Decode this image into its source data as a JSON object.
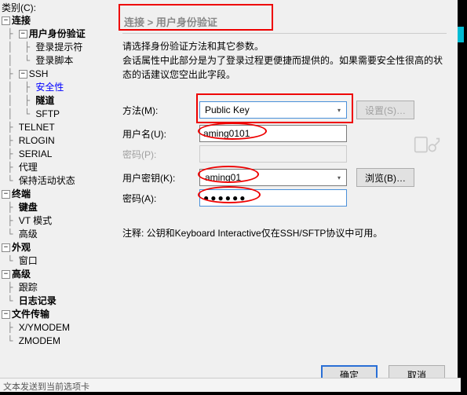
{
  "category_label": "类别(C):",
  "tree": {
    "connection": "连接",
    "auth": "用户身份验证",
    "login_prompt": "登录提示符",
    "login_script": "登录脚本",
    "ssh": "SSH",
    "security": "安全性",
    "tunnel": "隧道",
    "sftp": "SFTP",
    "telnet": "TELNET",
    "rlogin": "RLOGIN",
    "serial": "SERIAL",
    "proxy": "代理",
    "keepalive": "保持活动状态",
    "terminal": "终端",
    "keyboard": "键盘",
    "vt": "VT 模式",
    "advanced_t": "高级",
    "appearance": "外观",
    "window": "窗口",
    "advanced": "高级",
    "trace": "跟踪",
    "logging": "日志记录",
    "file_transfer": "文件传输",
    "xy": "X/YMODEM",
    "z": "ZMODEM"
  },
  "breadcrumb": "连接 > 用户身份验证",
  "desc_line1": "请选择身份验证方法和其它参数。",
  "desc_line2": "会话属性中此部分是为了登录过程更便捷而提供的。如果需要安全性很高的状态的话建议您空出此字段。",
  "labels": {
    "method": "方法(M):",
    "username": "用户名(U):",
    "password": "密码(P):",
    "userkey": "用户密钥(K):",
    "keypass": "密码(A):"
  },
  "values": {
    "method": "Public Key",
    "username": "aming0101",
    "userkey": "aming01",
    "keypass_masked": "●●●●●●"
  },
  "buttons": {
    "settings": "设置(S)…",
    "browse": "浏览(B)…",
    "ok": "确定",
    "cancel": "取消"
  },
  "note": "注释: 公钥和Keyboard Interactive仅在SSH/SFTP协议中可用。",
  "statusbar": "文本发送到当前选项卡"
}
